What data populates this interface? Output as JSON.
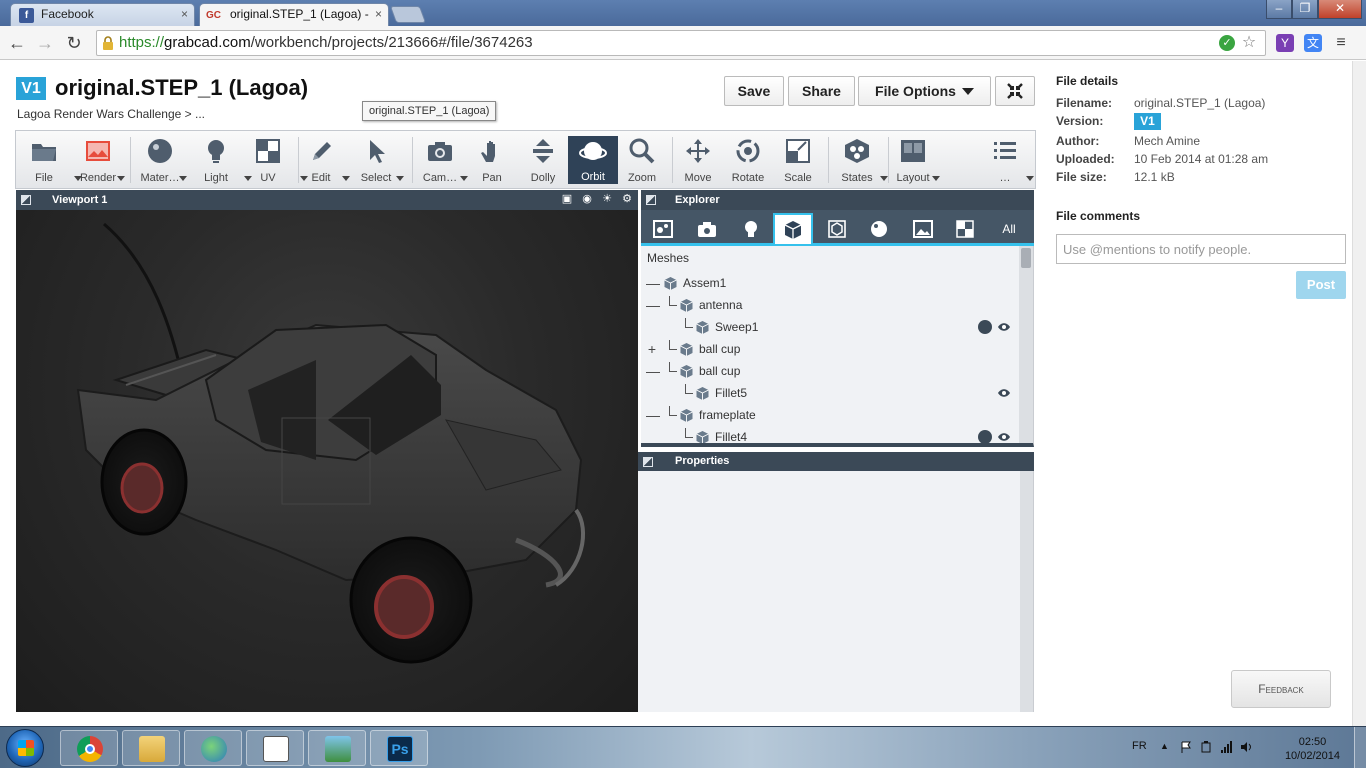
{
  "browser": {
    "tabs": [
      {
        "title": "Facebook",
        "favicon": "facebook-icon"
      },
      {
        "title": "original.STEP_1 (Lagoa) -",
        "favicon": "grabcad-icon",
        "favicon_text": "GC"
      }
    ],
    "url_scheme": "https://",
    "url_host": "grabcad.com",
    "url_path": "/workbench/projects/213666#/file/3674263"
  },
  "header": {
    "version_badge": "V1",
    "title": "original.STEP_1 (Lagoa)",
    "breadcrumb": "Lagoa Render Wars Challenge > ...",
    "tooltip": "original.STEP_1 (Lagoa)",
    "save_label": "Save",
    "share_label": "Share",
    "file_options_label": "File Options"
  },
  "toolbar": {
    "tools": [
      {
        "label": "File",
        "icon": "folder-icon"
      },
      {
        "label": "Render",
        "icon": "render-icon"
      },
      {
        "label": "Mater…",
        "icon": "material-sphere-icon"
      },
      {
        "label": "Light",
        "icon": "bulb-icon"
      },
      {
        "label": "UV",
        "icon": "checker-icon"
      },
      {
        "label": "Edit",
        "icon": "pencil-icon"
      },
      {
        "label": "Select",
        "icon": "cursor-icon"
      },
      {
        "label": "Cam…",
        "icon": "camera-icon"
      },
      {
        "label": "Pan",
        "icon": "hand-icon"
      },
      {
        "label": "Dolly",
        "icon": "dolly-icon"
      },
      {
        "label": "Orbit",
        "icon": "orbit-icon",
        "active": true
      },
      {
        "label": "Zoom",
        "icon": "magnifier-icon"
      },
      {
        "label": "Move",
        "icon": "move-icon"
      },
      {
        "label": "Rotate",
        "icon": "rotate-icon"
      },
      {
        "label": "Scale",
        "icon": "scale-icon"
      },
      {
        "label": "States",
        "icon": "states-icon"
      },
      {
        "label": "Layout",
        "icon": "layout-icon"
      },
      {
        "label": "…",
        "icon": "list-icon"
      }
    ]
  },
  "viewport": {
    "title": "Viewport 1"
  },
  "explorer": {
    "title": "Explorer",
    "all_tab": "All",
    "section": "Meshes",
    "tree": [
      {
        "name": "Assem1",
        "toggle": "—"
      },
      {
        "name": "antenna",
        "toggle": "—"
      },
      {
        "name": "Sweep1",
        "toggle": "",
        "material": true,
        "eye": true
      },
      {
        "name": "ball cup",
        "toggle": "+"
      },
      {
        "name": "ball cup",
        "toggle": "—"
      },
      {
        "name": "Fillet5",
        "toggle": "",
        "eye": true
      },
      {
        "name": "frameplate",
        "toggle": "—"
      },
      {
        "name": "Fillet4",
        "toggle": "",
        "material": true,
        "eye": true
      }
    ]
  },
  "properties": {
    "title": "Properties"
  },
  "file_details": {
    "heading": "File details",
    "filename_label": "Filename:",
    "filename": "original.STEP_1 (Lagoa)",
    "version_label": "Version:",
    "version": "V1",
    "author_label": "Author:",
    "author": "Mech Amine",
    "uploaded_label": "Uploaded:",
    "uploaded": "10 Feb 2014 at 01:28 am",
    "size_label": "File size:",
    "size": "12.1 kB"
  },
  "comments": {
    "heading": "File comments",
    "placeholder": "Use @mentions to notify people.",
    "post_label": "Post"
  },
  "feedback_label": "Feedback",
  "taskbar": {
    "lang": "FR",
    "time": "02:50",
    "date": "10/02/2014"
  },
  "colors": {
    "accent": "#29a3d8",
    "panel_header": "#3b4957",
    "tab_highlight": "#35c1ec"
  }
}
